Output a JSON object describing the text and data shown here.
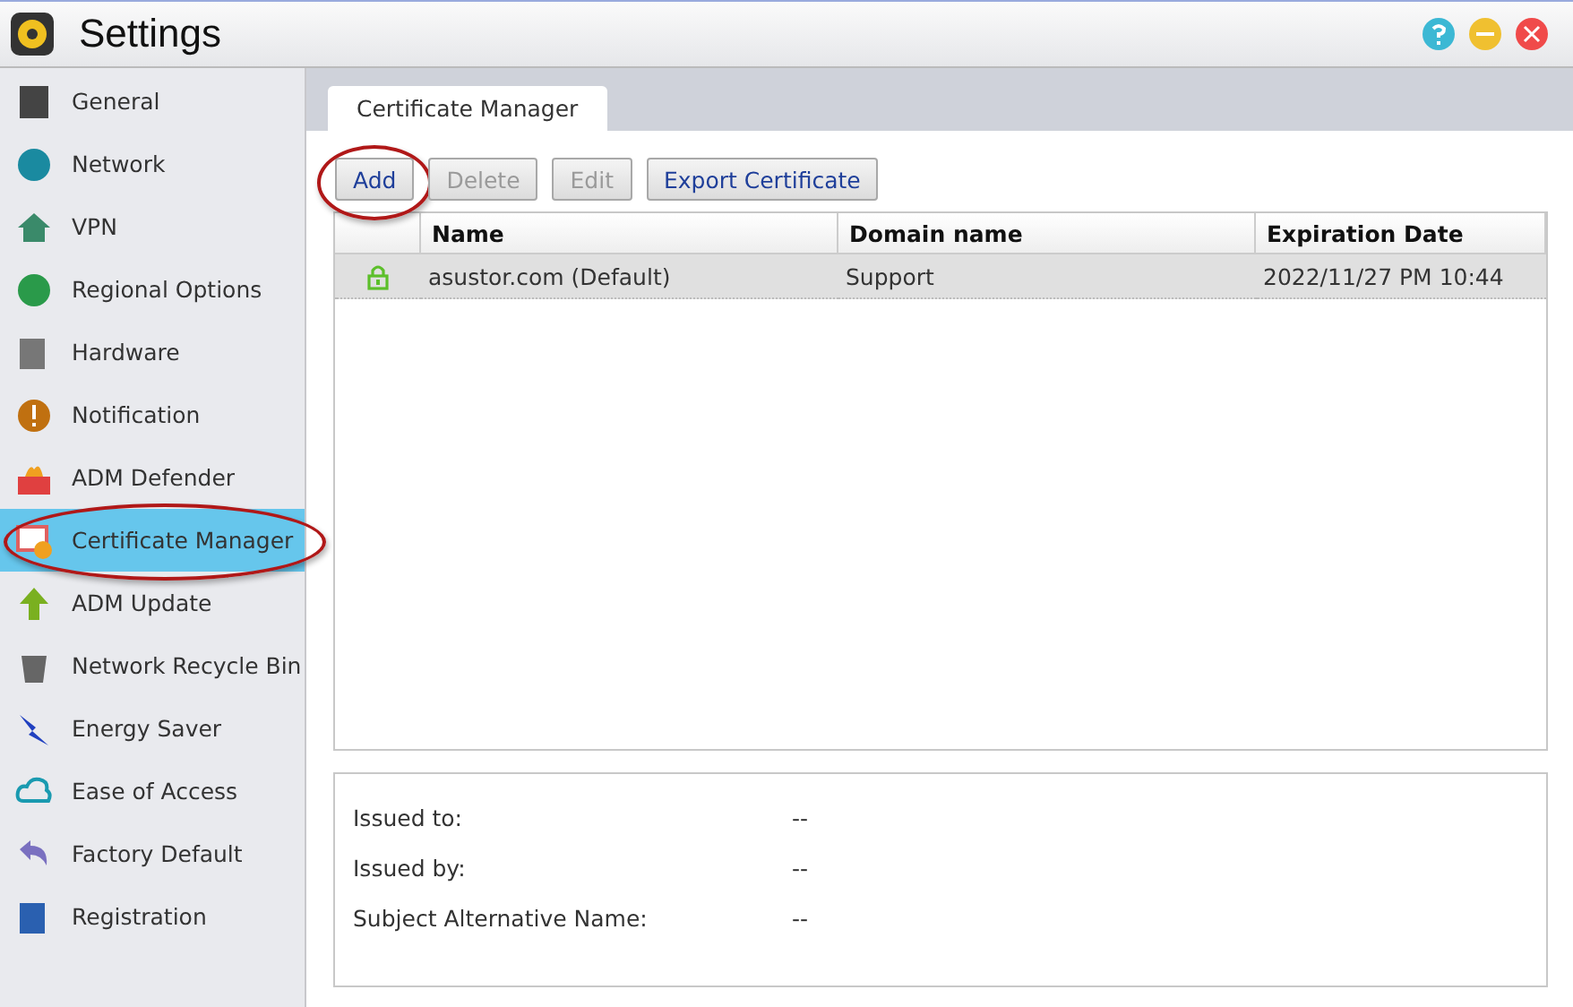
{
  "window": {
    "title": "Settings"
  },
  "sidebar": {
    "items": [
      {
        "label": "General",
        "selected": false,
        "annotated": false
      },
      {
        "label": "Network",
        "selected": false,
        "annotated": false
      },
      {
        "label": "VPN",
        "selected": false,
        "annotated": false
      },
      {
        "label": "Regional Options",
        "selected": false,
        "annotated": false
      },
      {
        "label": "Hardware",
        "selected": false,
        "annotated": false
      },
      {
        "label": "Notification",
        "selected": false,
        "annotated": false
      },
      {
        "label": "ADM Defender",
        "selected": false,
        "annotated": false
      },
      {
        "label": "Certificate Manager",
        "selected": true,
        "annotated": true
      },
      {
        "label": "ADM Update",
        "selected": false,
        "annotated": false
      },
      {
        "label": "Network Recycle Bin",
        "selected": false,
        "annotated": false
      },
      {
        "label": "Energy Saver",
        "selected": false,
        "annotated": false
      },
      {
        "label": "Ease of Access",
        "selected": false,
        "annotated": false
      },
      {
        "label": "Factory Default",
        "selected": false,
        "annotated": false
      },
      {
        "label": "Registration",
        "selected": false,
        "annotated": false
      }
    ]
  },
  "tabs": [
    {
      "label": "Certificate Manager",
      "selected": true
    }
  ],
  "toolbar": [
    {
      "label": "Add",
      "disabled": false,
      "annotated": true
    },
    {
      "label": "Delete",
      "disabled": true,
      "annotated": false
    },
    {
      "label": "Edit",
      "disabled": true,
      "annotated": false
    },
    {
      "label": "Export Certificate",
      "disabled": false,
      "annotated": false
    }
  ],
  "table": {
    "columns": [
      "Name",
      "Domain name",
      "Expiration Date"
    ],
    "rows": [
      {
        "selected": true,
        "cells": [
          "asustor.com (Default)",
          "Support",
          "2022/11/27 PM 10:44"
        ]
      }
    ]
  },
  "details": [
    {
      "label": "Issued to:",
      "value": "--"
    },
    {
      "label": "Issued by:",
      "value": "--"
    },
    {
      "label": "Subject Alternative Name:",
      "value": "--"
    }
  ]
}
